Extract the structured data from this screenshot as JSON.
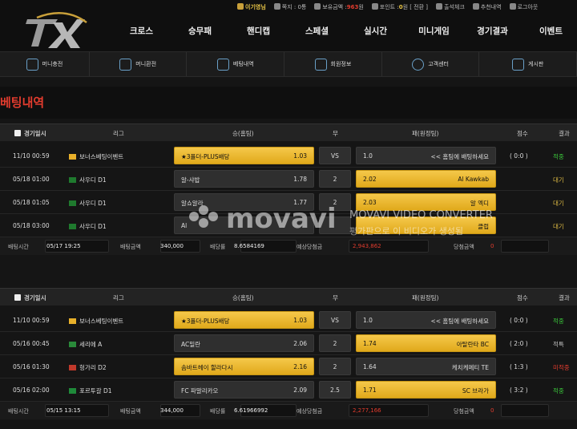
{
  "header": {
    "user": "이기영님",
    "notes": "쪽지 : 0통",
    "money_label": "보유금액 :",
    "money_value": "963",
    "money_unit": "원",
    "point_label": "포인트 :",
    "point_value": "0",
    "point_suffix": "원 [ 전환 ]",
    "attendance": "출석체크",
    "recommend": "추천내역",
    "logout": "로그아웃"
  },
  "nav": [
    "크로스",
    "승무패",
    "핸디캡",
    "스페셜",
    "실시간",
    "미니게임",
    "경기결과",
    "이벤트"
  ],
  "subnav": [
    "머니충전",
    "머니환전",
    "베팅내역",
    "회원정보",
    "고객센터",
    "게시판"
  ],
  "page_title": "베팅내역",
  "columns": {
    "date": "경기일시",
    "league": "리그",
    "home": "승(홈팀)",
    "draw": "무",
    "away": "패(원정팀)",
    "score": "점수",
    "result": "결과"
  },
  "tables": [
    {
      "rows": [
        {
          "date": "11/10 00:59",
          "league": "보너스베팅이벤트",
          "flag": "bonus",
          "home": "★3폴더-PLUS배당",
          "home_odds": "1.03",
          "draw": "VS",
          "away_odds": "1.0",
          "away": "<< 홈팀에 배팅하세요",
          "score": "( 0:0 )",
          "result": "적중",
          "result_type": "green",
          "pick": "home"
        },
        {
          "date": "05/18 01:00",
          "league": "사우디 D1",
          "flag": "saudi",
          "home": "알-샤밥",
          "home_odds": "1.78",
          "draw": "2",
          "away_odds": "2.02",
          "away": "Al Kawkab",
          "score": "",
          "result": "대기",
          "result_type": "yel",
          "pick": "away"
        },
        {
          "date": "05/18 01:05",
          "league": "사우디 D1",
          "flag": "saudi",
          "home": "알쇼알라",
          "home_odds": "1.77",
          "draw": "2",
          "away_odds": "2.03",
          "away": "알 엑디",
          "score": "",
          "result": "대기",
          "result_type": "yel",
          "pick": "away"
        },
        {
          "date": "05/18 03:00",
          "league": "사우디 D1",
          "flag": "saudi",
          "home": "Al",
          "home_odds": "",
          "draw": "",
          "away_odds": "",
          "away": "클럽",
          "score": "",
          "result": "대기",
          "result_type": "yel",
          "pick": "away"
        }
      ],
      "footer": {
        "time_label": "배팅시간",
        "time": "05/17 19:25",
        "amount_label": "배팅금액",
        "amount": "340,000",
        "odds_label": "배당률",
        "odds": "8.6584169",
        "expected_label": "예상당첨금",
        "expected": "2,943,862",
        "win_label": "당첨금액",
        "win": "0"
      }
    },
    {
      "rows": [
        {
          "date": "11/10 00:59",
          "league": "보너스베팅이벤트",
          "flag": "bonus",
          "home": "★3폴더-PLUS배당",
          "home_odds": "1.03",
          "draw": "VS",
          "away_odds": "1.0",
          "away": "<< 홈팀에 배팅하세요",
          "score": "( 0:0 )",
          "result": "적중",
          "result_type": "green",
          "pick": "home"
        },
        {
          "date": "05/16 00:45",
          "league": "세리에 A",
          "flag": "italy",
          "home": "AC밀란",
          "home_odds": "2.06",
          "draw": "2",
          "away_odds": "1.74",
          "away": "아탈란타 BC",
          "score": "( 2:0 )",
          "result": "적특",
          "result_type": "gray",
          "pick": "away"
        },
        {
          "date": "05/16 01:30",
          "league": "헝가리 D2",
          "flag": "hungary",
          "home": "솜바트헤이 할라다시",
          "home_odds": "2.16",
          "draw": "2",
          "away_odds": "1.64",
          "away": "케치케메티 TE",
          "score": "( 1:3 )",
          "result": "미적중",
          "result_type": "red",
          "pick": "home"
        },
        {
          "date": "05/16 02:00",
          "league": "포르투갈 D1",
          "flag": "portugal",
          "home": "FC 파말리카오",
          "home_odds": "2.09",
          "draw": "2.5",
          "away_odds": "1.71",
          "away": "SC 브라가",
          "score": "( 3:2 )",
          "result": "적중",
          "result_type": "green",
          "pick": "away"
        }
      ],
      "footer": {
        "time_label": "배팅시간",
        "time": "05/15 13:15",
        "amount_label": "배팅금액",
        "amount": "344,000",
        "odds_label": "배당률",
        "odds": "6.61966992",
        "expected_label": "예상당첨금",
        "expected": "2,277,166",
        "win_label": "당첨금액",
        "win": "0"
      }
    }
  ],
  "watermark": {
    "brand": "movavi",
    "product": "MOVAVI VIDEO CONVERTER",
    "trial": "평가판으로 이 비디오가 생성됨"
  },
  "colors": {
    "accent": "#e23c2e",
    "gold": "#f0bd34",
    "green": "#3ac43a"
  }
}
